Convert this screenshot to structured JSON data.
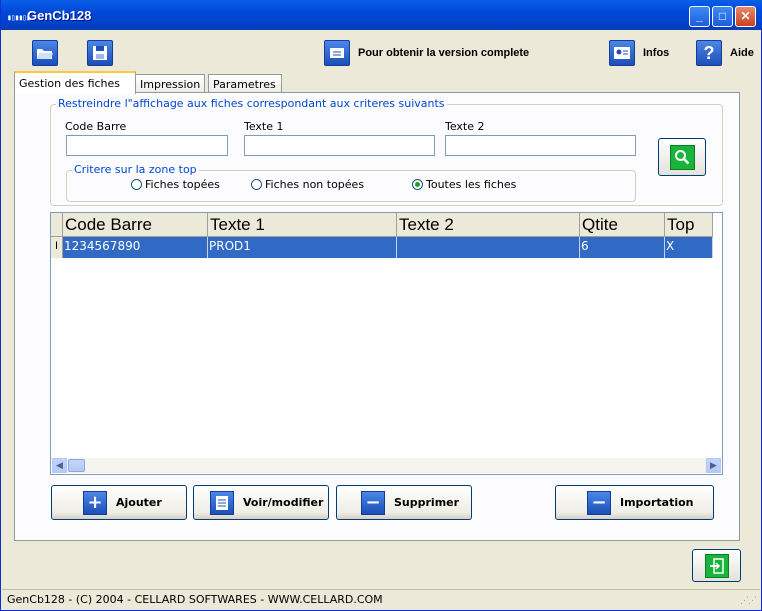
{
  "window": {
    "title": "GenCb128",
    "icon": "barcode-icon"
  },
  "titlebar_buttons": {
    "minimize": "_",
    "maximize": "□",
    "close": "✕"
  },
  "toolbar": {
    "open_icon": "folder-open-icon",
    "save_icon": "floppy-disk-icon",
    "full_version_label": "Pour obtenir la version complete",
    "infos_label": "Infos",
    "aide_label": "Aide"
  },
  "tabs": [
    {
      "label": "Gestion des fiches",
      "active": true
    },
    {
      "label": "Impression",
      "active": false
    },
    {
      "label": "Parametres",
      "active": false
    }
  ],
  "filter": {
    "title": "Restreindre l\"affichage aux fiches correspondant aux criteres suivants",
    "code_barre_label": "Code Barre",
    "texte1_label": "Texte 1",
    "texte2_label": "Texte 2",
    "code_barre_value": "",
    "texte1_value": "",
    "texte2_value": "",
    "top_group_title": "Critere sur la zone top",
    "radio_options": [
      {
        "label": "Fiches topées",
        "checked": false
      },
      {
        "label": "Fiches non topées",
        "checked": false
      },
      {
        "label": "Toutes les fiches",
        "checked": true
      }
    ]
  },
  "grid": {
    "columns": [
      "Code Barre",
      "Texte 1",
      "Texte 2",
      "Qtite",
      "Top"
    ],
    "rows": [
      {
        "indicator": "I",
        "cells": [
          "1234567890",
          "PROD1",
          "",
          "6",
          "X"
        ],
        "selected": true
      }
    ]
  },
  "actions": {
    "ajouter": "Ajouter",
    "voir_modifier": "Voir/modifier",
    "supprimer": "Supprimer",
    "importation": "Importation"
  },
  "status": {
    "text": "GenCb128 - (C) 2004 - CELLARD SOFTWARES - WWW.CELLARD.COM"
  },
  "colors": {
    "selection": "#316AC5",
    "titlebar": "#0054E3",
    "accent_green": "#19B43C"
  }
}
